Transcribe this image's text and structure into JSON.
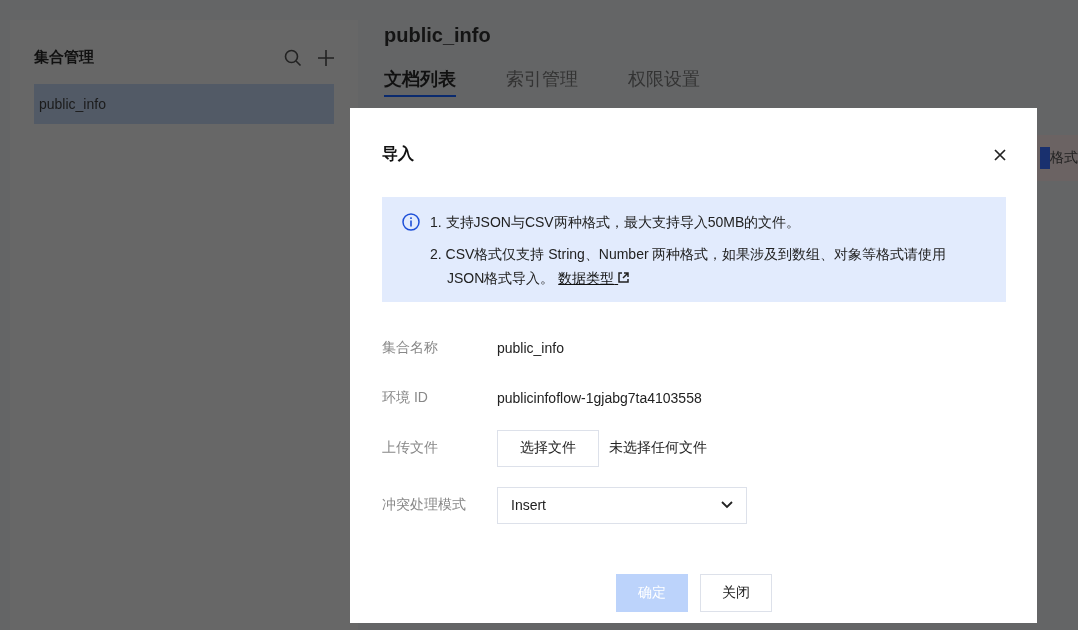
{
  "sidebar": {
    "title": "集合管理",
    "items": [
      {
        "label": "public_info",
        "selected": true
      }
    ]
  },
  "main": {
    "title": "public_info",
    "tabs": [
      {
        "label": "文档列表",
        "selected": true
      },
      {
        "label": "索引管理",
        "selected": false
      },
      {
        "label": "权限设置",
        "selected": false
      }
    ],
    "notice_fragment": "格式"
  },
  "dialog": {
    "title": "导入",
    "notes": [
      {
        "text": "1. 支持JSON与CSV两种格式，最大支持导入50MB的文件。"
      },
      {
        "text": "2. CSV格式仅支持 String、Number 两种格式，如果涉及到数组、对象等格式请使用JSON格式导入。",
        "link": "数据类型"
      }
    ],
    "fields": [
      {
        "kind": "text",
        "label": "集合名称",
        "value": "public_info"
      },
      {
        "kind": "text",
        "label": "环境 ID",
        "value": "publicinfoflow-1gjabg7ta4103558"
      },
      {
        "kind": "file",
        "label": "上传文件",
        "button": "选择文件",
        "value": "未选择任何文件"
      },
      {
        "kind": "select",
        "label": "冲突处理模式",
        "value": "Insert"
      }
    ],
    "buttons": [
      {
        "label": "确定",
        "disabled": true
      },
      {
        "label": "关闭",
        "disabled": false
      }
    ]
  }
}
